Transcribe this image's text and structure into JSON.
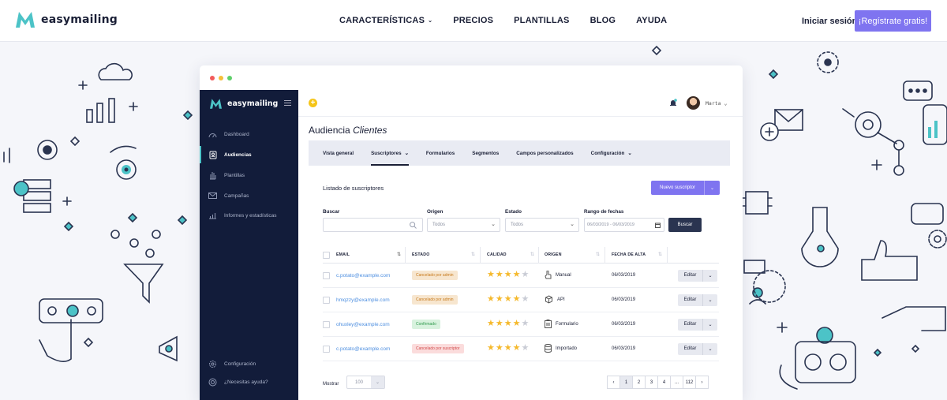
{
  "site": {
    "brand": "easymailing",
    "nav": [
      {
        "label": "CARACTERÍSTICAS",
        "dropdown": true
      },
      {
        "label": "PRECIOS",
        "dropdown": false
      },
      {
        "label": "PLANTILLAS",
        "dropdown": false
      },
      {
        "label": "BLOG",
        "dropdown": false
      },
      {
        "label": "AYUDA",
        "dropdown": false
      }
    ],
    "login_label": "Iniciar sesión",
    "register_label": "¡Regístrate gratis!",
    "accent": "#7f74f0",
    "brand_teal": "#4cc3c7"
  },
  "app": {
    "brand": "easymailing",
    "window_dots": [
      "#f25b5b",
      "#f5bf3a",
      "#5fcf6a"
    ],
    "sidebar": {
      "items": [
        {
          "label": "Dashboard",
          "icon": "gauge-icon",
          "active": false
        },
        {
          "label": "Audiencias",
          "icon": "contact-card-icon",
          "active": true
        },
        {
          "label": "Plantillas",
          "icon": "hand-icon",
          "active": false
        },
        {
          "label": "Campañas",
          "icon": "envelope-icon",
          "active": false
        },
        {
          "label": "Informes y estadísticas",
          "icon": "bar-chart-icon",
          "active": false
        }
      ],
      "bottom": [
        {
          "label": "Configuración",
          "icon": "gear-icon"
        },
        {
          "label": "¿Necesitas ayuda?",
          "icon": "lifebuoy-icon"
        }
      ]
    },
    "header": {
      "user": "Marta"
    },
    "page_title": "Audiencia",
    "page_title_em": "Clientes",
    "tabs": [
      {
        "label": "Vista general",
        "dropdown": false,
        "active": false
      },
      {
        "label": "Suscriptores",
        "dropdown": true,
        "active": true
      },
      {
        "label": "Formularios",
        "dropdown": false,
        "active": false
      },
      {
        "label": "Segmentos",
        "dropdown": false,
        "active": false
      },
      {
        "label": "Campos personalizados",
        "dropdown": false,
        "active": false
      },
      {
        "label": "Configuración",
        "dropdown": true,
        "active": false
      }
    ],
    "list": {
      "title": "Listado de suscriptores",
      "new_button": "Nuevo suscriptor",
      "filters": {
        "search_label": "Buscar",
        "search_value": "",
        "origin_label": "Origen",
        "origin_value": "Todos",
        "state_label": "Estado",
        "state_value": "Todos",
        "date_label": "Rango de fechas",
        "date_value": "06/03/2019 - 06/03/2019",
        "search_button": "Buscar"
      },
      "columns": [
        "EMAIL",
        "ESTADO",
        "CALIDAD",
        "ORIGEN",
        "FECHA DE ALTA"
      ],
      "rows": [
        {
          "email": "c.potato@example.com",
          "status": "Cancelado por admin",
          "status_color": "#f7e6cf",
          "status_text": "#c77a1c",
          "stars": 4,
          "origin": "Manual",
          "origin_icon": "hand-pointer-icon",
          "date": "06/03/2019",
          "action": "Editar"
        },
        {
          "email": "hmqzzy@example.com",
          "status": "Cancelado por admin",
          "status_color": "#f7e6cf",
          "status_text": "#c77a1c",
          "stars": 4,
          "origin": "API",
          "origin_icon": "cube-icon",
          "date": "06/03/2019",
          "action": "Editar"
        },
        {
          "email": "ohuxley@example.com",
          "status": "Confirmado",
          "status_color": "#d8f2de",
          "status_text": "#2f9a4c",
          "stars": 4,
          "origin": "Formulario",
          "origin_icon": "clipboard-icon",
          "date": "06/03/2019",
          "action": "Editar"
        },
        {
          "email": "c.potato@example.com",
          "status": "Cancelado por suscriptor",
          "status_color": "#fbdcdc",
          "status_text": "#d24a4a",
          "stars": 4,
          "origin": "Importado",
          "origin_icon": "database-icon",
          "date": "06/03/2019",
          "action": "Editar"
        }
      ],
      "show_label": "Mostrar",
      "show_value": "100",
      "pages": [
        "1",
        "2",
        "3",
        "4",
        "...",
        "112"
      ],
      "current_page": "1"
    }
  }
}
